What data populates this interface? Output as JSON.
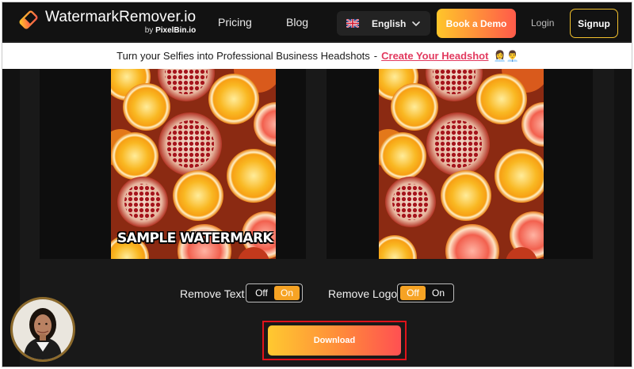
{
  "brand": {
    "name": "WatermarkRemover.io",
    "by_prefix": "by",
    "by_name": "PixelBin.io"
  },
  "nav": {
    "links": [
      {
        "label": "Pricing"
      },
      {
        "label": "Blog"
      }
    ],
    "language": "English",
    "demo_label": "Book a Demo",
    "login_label": "Login",
    "signup_label": "Signup"
  },
  "banner": {
    "text": "Turn your Selfies into Professional Business Headshots",
    "separator": "-",
    "link_label": "Create Your Headshot",
    "emoji": "👩‍💼👨‍💼"
  },
  "preview": {
    "original_watermark": "SAMPLE WATERMARK"
  },
  "controls": {
    "remove_text": {
      "label": "Remove Text",
      "off": "Off",
      "on": "On",
      "selected": "On"
    },
    "remove_logo": {
      "label": "Remove Logo",
      "off": "Off",
      "on": "On",
      "selected": "Off"
    }
  },
  "download_label": "Download",
  "colors": {
    "background": "#121212",
    "accent_start": "#ffc62a",
    "accent_end": "#ff5a4a",
    "link": "#e23a5f",
    "highlight_border": "#e0131b",
    "toggle_active": "#f6a324"
  },
  "icons": {
    "logo": "eraser-logo-icon",
    "flag": "uk-flag-icon",
    "dropdown": "chevron-down-icon",
    "avatar": "support-avatar"
  }
}
